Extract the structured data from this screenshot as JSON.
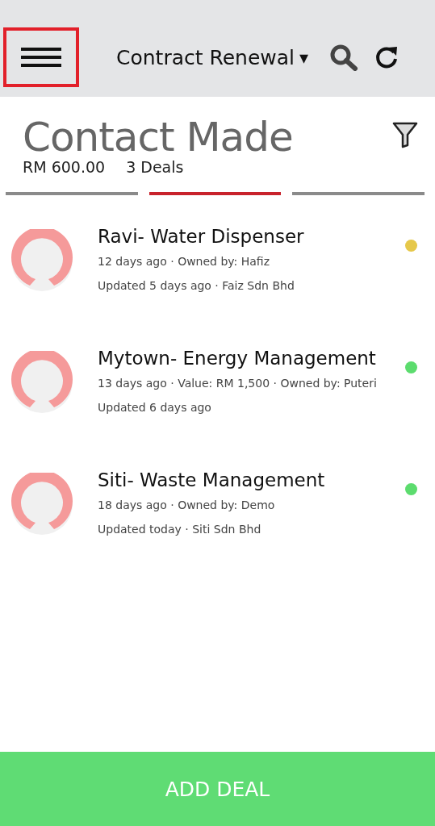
{
  "header": {
    "menu_highlighted": true,
    "pipeline": "Contract Renewal",
    "dropdown_caret": "▾"
  },
  "stage": {
    "title": "Contact Made",
    "total": "RM 600.00",
    "count": "3 Deals"
  },
  "stage_tabs": [
    {
      "selected": false
    },
    {
      "selected": true
    },
    {
      "selected": false
    }
  ],
  "deals": [
    {
      "title": "Ravi- Water Dispenser",
      "meta": [
        "12 days ago · Owned by: Hafiz",
        "Updated 5 days ago · Faiz Sdn Bhd"
      ],
      "color": "#e6c84a"
    },
    {
      "title": "Mytown- Energy Management",
      "meta": [
        "13 days ago · Value: RM 1,500 · Owned by: Puteri",
        "Updated 6 days ago"
      ],
      "color": "#5cdc6e"
    },
    {
      "title": "Siti- Waste Management",
      "meta": [
        "18 days ago · Owned by: Demo",
        "Updated today · Siti Sdn Bhd"
      ],
      "color": "#5cdc6e"
    }
  ],
  "add_button": "ADD DEAL"
}
